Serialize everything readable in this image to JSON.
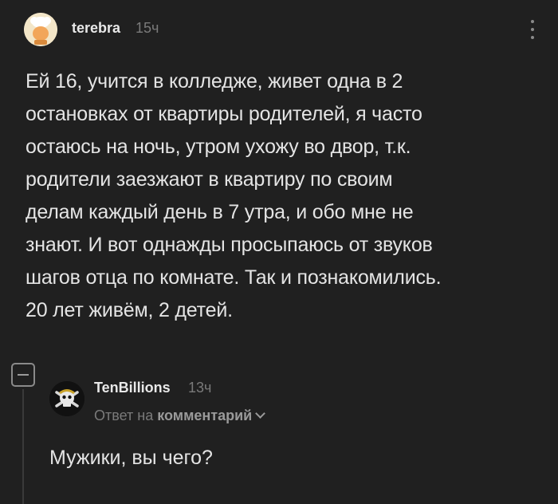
{
  "comment": {
    "author": "terebra",
    "time": "15ч",
    "avatar_icon": "chef-avatar-icon",
    "menu_icon": "more-vertical-icon",
    "text": "Ей 16, учится в колледже, живет одна в 2\nостановках от квартиры родителей, я часто\nостаюсь на ночь, утром ухожу во двор, т.к.\nродители заезжают в квартиру по своим\nделам каждый день в 7 утра, и обо мне не\nзнают. И вот однажды просыпаюсь от звуков\nшагов отца по комнате. Так и познакомились.\n20 лет живём, 2 детей."
  },
  "reply": {
    "author": "TenBillions",
    "time": "13ч",
    "avatar_icon": "jolly-roger-avatar-icon",
    "reply_prefix": "Ответ на",
    "reply_link": "комментарий",
    "text": "Мужики, вы чего?"
  },
  "thread": {
    "collapse_icon": "collapse-minus-icon"
  },
  "colors": {
    "background": "#202020",
    "text": "#e4e4e4",
    "muted": "#7a7a7a"
  }
}
